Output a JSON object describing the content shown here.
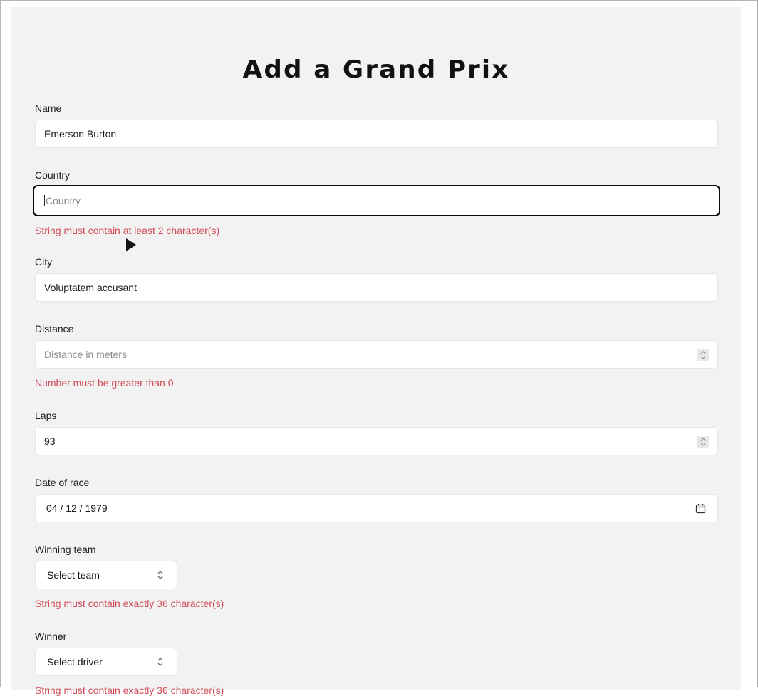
{
  "page": {
    "title": "Add a Grand Prix"
  },
  "fields": {
    "name": {
      "label": "Name",
      "value": "Emerson Burton",
      "placeholder": ""
    },
    "country": {
      "label": "Country",
      "value": "",
      "placeholder": "Country",
      "error": "String must contain at least 2 character(s)"
    },
    "city": {
      "label": "City",
      "value": "Voluptatem accusant"
    },
    "distance": {
      "label": "Distance",
      "value": "",
      "placeholder": "Distance in meters",
      "error": "Number must be greater than 0"
    },
    "laps": {
      "label": "Laps",
      "value": "93"
    },
    "date": {
      "label": "Date of race",
      "value": "04 / 12 / 1979"
    },
    "winning_team": {
      "label": "Winning team",
      "value": "Select team",
      "error": "String must contain exactly 36 character(s)"
    },
    "winner": {
      "label": "Winner",
      "value": "Select driver",
      "error": "String must contain exactly 36 character(s)"
    }
  },
  "colors": {
    "error": "#d14b57",
    "panel": "#f2f2f2",
    "focus_border": "#0a0a0a"
  }
}
